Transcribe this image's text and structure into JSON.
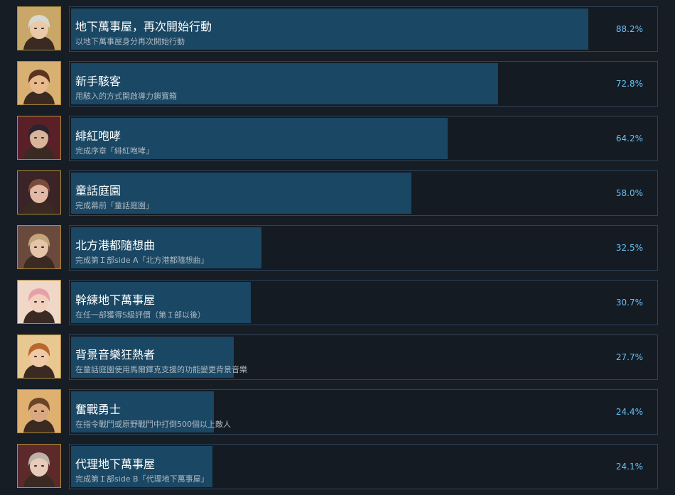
{
  "achievements": [
    {
      "title": "地下萬事屋，再次開始行動",
      "description": "以地下萬事屋身分再次開始行動",
      "percent_label": "88.2%",
      "percent": 88.2,
      "icon": "character-portrait-white-hair-goggles",
      "colors": {
        "skin": "#e9c9a8",
        "hair": "#d8d8d0",
        "bg": "#c9a769"
      }
    },
    {
      "title": "新手駭客",
      "description": "用駭入的方式開啟導力鎖寶箱",
      "percent_label": "72.8%",
      "percent": 72.8,
      "icon": "character-portrait-white-bandana",
      "colors": {
        "skin": "#e7b98d",
        "hair": "#5a3420",
        "bg": "#d8b072"
      }
    },
    {
      "title": "緋紅咆哮",
      "description": "完成序章「緋紅咆哮」",
      "percent_label": "64.2%",
      "percent": 64.2,
      "icon": "character-portrait-dark-hair",
      "colors": {
        "skin": "#d7b49a",
        "hair": "#2b2430",
        "bg": "#5a2028"
      }
    },
    {
      "title": "童話庭園",
      "description": "完成幕前「童話庭園」",
      "percent_label": "58.0%",
      "percent": 58.0,
      "icon": "character-portrait-two-girls",
      "colors": {
        "skin": "#e3b9a6",
        "hair": "#7a4a3a",
        "bg": "#3a2428"
      }
    },
    {
      "title": "北方港都隨想曲",
      "description": "完成第Ｉ部side A「北方港都隨想曲」",
      "percent_label": "32.5%",
      "percent": 32.5,
      "icon": "character-portrait-blonde-woman",
      "colors": {
        "skin": "#e6c4aa",
        "hair": "#c4a57b",
        "bg": "#6a4a3c"
      }
    },
    {
      "title": "幹練地下萬事屋",
      "description": "在任一部獲得S級評價（第Ｉ部以後）",
      "percent_label": "30.7%",
      "percent": 30.7,
      "icon": "character-portrait-pink-hair-bear",
      "colors": {
        "skin": "#f2d0be",
        "hair": "#e8a0a8",
        "bg": "#f0d8c8"
      }
    },
    {
      "title": "背景音樂狂熱者",
      "description": "在童話庭園使用馬爾鐸克支援的功能變更背景音樂",
      "percent_label": "27.7%",
      "percent": 27.7,
      "icon": "character-portrait-glasses-girl",
      "colors": {
        "skin": "#f0c9a6",
        "hair": "#b8672e",
        "bg": "#e8c890"
      }
    },
    {
      "title": "奮戰勇士",
      "description": "在指令戰鬥或原野戰鬥中打倒500個以上敵人",
      "percent_label": "24.4%",
      "percent": 24.4,
      "icon": "character-portrait-brown-hair-man",
      "colors": {
        "skin": "#d9a780",
        "hair": "#6b4428",
        "bg": "#e0b070"
      }
    },
    {
      "title": "代理地下萬事屋",
      "description": "完成第Ｉ部side B「代理地下萬事屋」",
      "percent_label": "24.1%",
      "percent": 24.1,
      "icon": "character-portrait-grey-hair-woman",
      "colors": {
        "skin": "#e8cbb8",
        "hair": "#bdb2aa",
        "bg": "#5c2a2a"
      }
    }
  ]
}
